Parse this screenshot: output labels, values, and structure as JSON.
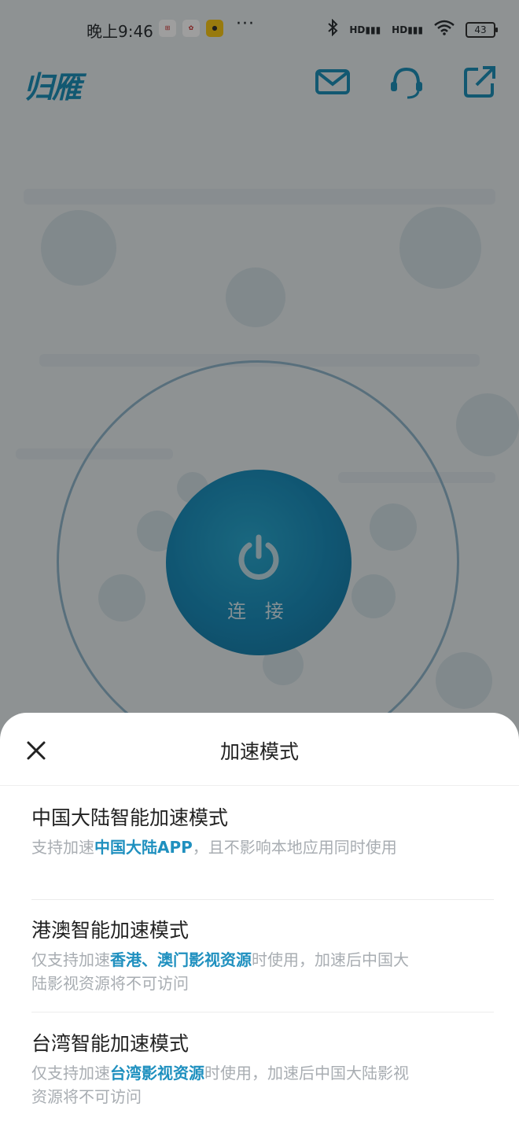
{
  "status_bar": {
    "time": "晚上9:46",
    "more": "···",
    "battery": "43",
    "signal_label": "HD"
  },
  "header": {
    "logo": "归雁",
    "icons": [
      "mail-icon",
      "customer-service-icon",
      "share-icon"
    ]
  },
  "connect": {
    "label": "连 接",
    "colors": {
      "button": "#1a8ab8",
      "ring": "#8fb4c8"
    }
  },
  "sheet": {
    "title": "加速模式",
    "modes": [
      {
        "title": "中国大陆智能加速模式",
        "desc_before": "支持加速",
        "desc_highlight": "中国大陆APP",
        "desc_after": "，且不影响本地应用同时使用"
      },
      {
        "title": "港澳智能加速模式",
        "desc_before": "仅支持加速",
        "desc_highlight": "香港、澳门影视资源",
        "desc_after": "时使用，加速后中国大陆影视资源将不可访问"
      },
      {
        "title": "台湾智能加速模式",
        "desc_before": "仅支持加速",
        "desc_highlight": "台湾影视资源",
        "desc_after": "时使用，加速后中国大陆影视资源将不可访问"
      }
    ]
  },
  "colors": {
    "accent": "#1f90bf",
    "muted_text": "#a8adb2",
    "primary_text": "#222222"
  }
}
